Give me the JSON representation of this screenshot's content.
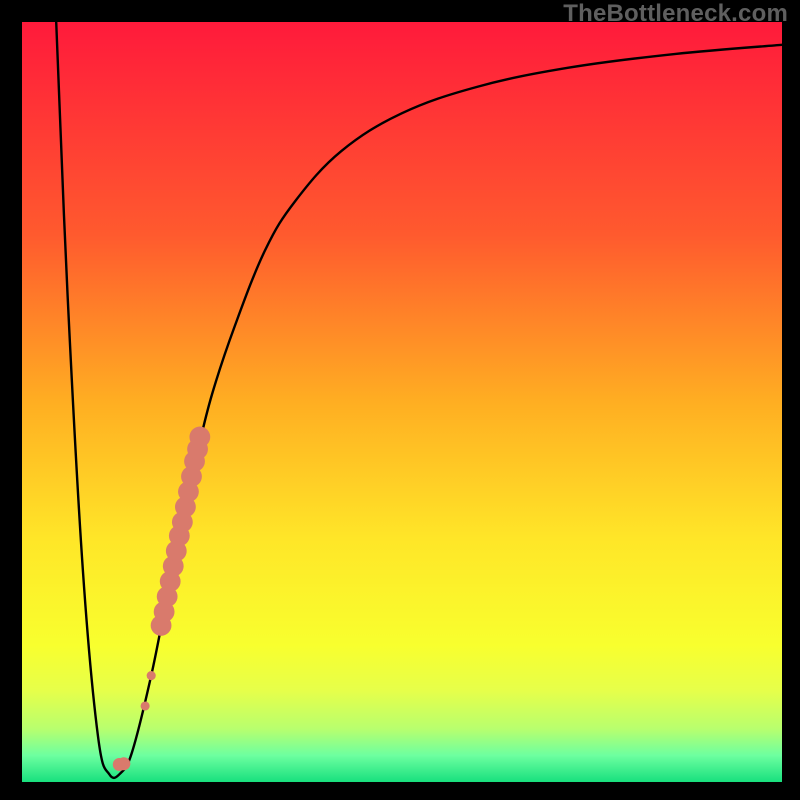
{
  "watermark": "TheBottleneck.com",
  "chart_data": {
    "type": "line",
    "title": "",
    "xlabel": "",
    "ylabel": "",
    "xlim": [
      0,
      100
    ],
    "ylim": [
      0,
      100
    ],
    "curve": {
      "x": [
        4.5,
        6,
        8,
        10,
        11.5,
        13,
        14.5,
        17,
        19,
        21,
        23,
        25,
        28,
        32,
        36,
        42,
        50,
        60,
        72,
        86,
        100
      ],
      "y": [
        100,
        64,
        28,
        6,
        1,
        1.2,
        4,
        14,
        24,
        34,
        43,
        51,
        60,
        70,
        76.5,
        83,
        88,
        91.5,
        94,
        95.8,
        97
      ]
    },
    "markers": {
      "series": [
        {
          "x": 12.8,
          "y": 2.3,
          "r": 1.0
        },
        {
          "x": 13.4,
          "y": 2.4,
          "r": 1.0
        },
        {
          "x": 16.2,
          "y": 10.0,
          "r": 0.7
        },
        {
          "x": 17.0,
          "y": 14.0,
          "r": 0.7
        },
        {
          "x": 18.3,
          "y": 20.6,
          "r": 1.6
        },
        {
          "x": 18.7,
          "y": 22.4,
          "r": 1.6
        },
        {
          "x": 19.1,
          "y": 24.4,
          "r": 1.6
        },
        {
          "x": 19.5,
          "y": 26.4,
          "r": 1.6
        },
        {
          "x": 19.9,
          "y": 28.4,
          "r": 1.6
        },
        {
          "x": 20.3,
          "y": 30.4,
          "r": 1.6
        },
        {
          "x": 20.7,
          "y": 32.4,
          "r": 1.6
        },
        {
          "x": 21.1,
          "y": 34.2,
          "r": 1.6
        },
        {
          "x": 21.5,
          "y": 36.2,
          "r": 1.6
        },
        {
          "x": 21.9,
          "y": 38.2,
          "r": 1.6
        },
        {
          "x": 22.3,
          "y": 40.2,
          "r": 1.6
        },
        {
          "x": 22.7,
          "y": 42.2,
          "r": 1.6
        },
        {
          "x": 23.1,
          "y": 43.8,
          "r": 1.6
        },
        {
          "x": 23.4,
          "y": 45.4,
          "r": 1.6
        }
      ],
      "color": "#d97a6c"
    },
    "gradient_stops": [
      {
        "offset": 0,
        "color": "#ff1a3b"
      },
      {
        "offset": 0.28,
        "color": "#ff5a2e"
      },
      {
        "offset": 0.5,
        "color": "#ffae22"
      },
      {
        "offset": 0.68,
        "color": "#ffe628"
      },
      {
        "offset": 0.82,
        "color": "#f8ff2e"
      },
      {
        "offset": 0.88,
        "color": "#e6ff4a"
      },
      {
        "offset": 0.93,
        "color": "#b8ff6e"
      },
      {
        "offset": 0.965,
        "color": "#6dffa0"
      },
      {
        "offset": 1.0,
        "color": "#18e07e"
      }
    ]
  }
}
